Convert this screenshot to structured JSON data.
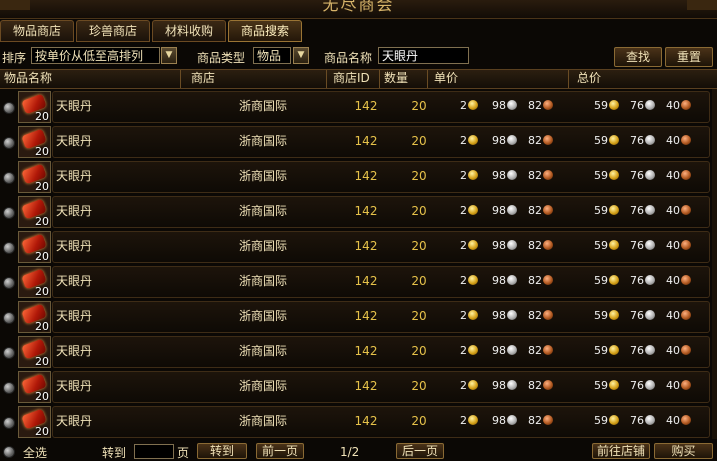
{
  "window": {
    "title": "无尽商会"
  },
  "tabs": [
    {
      "label": "物品商店"
    },
    {
      "label": "珍兽商店"
    },
    {
      "label": "材料收购"
    },
    {
      "label": "商品搜索"
    }
  ],
  "toolbar": {
    "sort_label": "排序",
    "sort_value": "按单价从低至高排列",
    "type_label": "商品类型",
    "type_value": "物品",
    "name_label": "商品名称",
    "name_value": "天眼丹",
    "search_button": "查找",
    "reset_button": "重置"
  },
  "columns": {
    "item_name": "物品名称",
    "shop": "商店",
    "shop_id": "商店ID",
    "quantity": "数量",
    "unit_price": "单价",
    "total_price": "总价"
  },
  "rows": [
    {
      "qty_badge": "20",
      "name": "天眼丹",
      "shop": "浙商国际",
      "shop_id": "142",
      "quantity": "20",
      "unit": [
        "2",
        "98",
        "82"
      ],
      "total": [
        "59",
        "76",
        "40"
      ]
    },
    {
      "qty_badge": "20",
      "name": "天眼丹",
      "shop": "浙商国际",
      "shop_id": "142",
      "quantity": "20",
      "unit": [
        "2",
        "98",
        "82"
      ],
      "total": [
        "59",
        "76",
        "40"
      ]
    },
    {
      "qty_badge": "20",
      "name": "天眼丹",
      "shop": "浙商国际",
      "shop_id": "142",
      "quantity": "20",
      "unit": [
        "2",
        "98",
        "82"
      ],
      "total": [
        "59",
        "76",
        "40"
      ]
    },
    {
      "qty_badge": "20",
      "name": "天眼丹",
      "shop": "浙商国际",
      "shop_id": "142",
      "quantity": "20",
      "unit": [
        "2",
        "98",
        "82"
      ],
      "total": [
        "59",
        "76",
        "40"
      ]
    },
    {
      "qty_badge": "20",
      "name": "天眼丹",
      "shop": "浙商国际",
      "shop_id": "142",
      "quantity": "20",
      "unit": [
        "2",
        "98",
        "82"
      ],
      "total": [
        "59",
        "76",
        "40"
      ]
    },
    {
      "qty_badge": "20",
      "name": "天眼丹",
      "shop": "浙商国际",
      "shop_id": "142",
      "quantity": "20",
      "unit": [
        "2",
        "98",
        "82"
      ],
      "total": [
        "59",
        "76",
        "40"
      ]
    },
    {
      "qty_badge": "20",
      "name": "天眼丹",
      "shop": "浙商国际",
      "shop_id": "142",
      "quantity": "20",
      "unit": [
        "2",
        "98",
        "82"
      ],
      "total": [
        "59",
        "76",
        "40"
      ]
    },
    {
      "qty_badge": "20",
      "name": "天眼丹",
      "shop": "浙商国际",
      "shop_id": "142",
      "quantity": "20",
      "unit": [
        "2",
        "98",
        "82"
      ],
      "total": [
        "59",
        "76",
        "40"
      ]
    },
    {
      "qty_badge": "20",
      "name": "天眼丹",
      "shop": "浙商国际",
      "shop_id": "142",
      "quantity": "20",
      "unit": [
        "2",
        "98",
        "82"
      ],
      "total": [
        "59",
        "76",
        "40"
      ]
    },
    {
      "qty_badge": "20",
      "name": "天眼丹",
      "shop": "浙商国际",
      "shop_id": "142",
      "quantity": "20",
      "unit": [
        "2",
        "98",
        "82"
      ],
      "total": [
        "59",
        "76",
        "40"
      ]
    }
  ],
  "footer": {
    "select_all": "全选",
    "goto_label": "转到",
    "page_unit": "页",
    "goto_button": "转到",
    "prev_button": "前一页",
    "page_indicator": "1/2",
    "next_button": "后一页",
    "visit_shop_button": "前往店铺",
    "buy_button": "购买"
  },
  "icons": {
    "item": "red-pill-icon",
    "gold_coin": "gold-coin-icon",
    "silver_coin": "silver-coin-icon",
    "copper_coin": "copper-coin-icon",
    "dropdown": "chevron-down-icon"
  }
}
